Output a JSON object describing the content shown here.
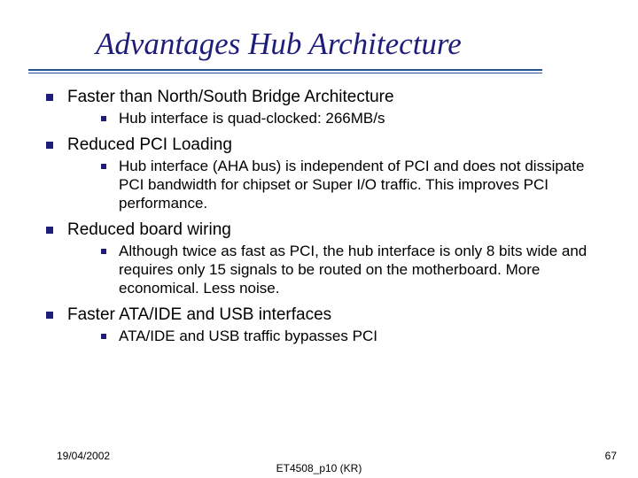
{
  "title": "Advantages Hub Architecture",
  "bullets": [
    {
      "text": "Faster than North/South Bridge Architecture",
      "sub": [
        "Hub interface is quad-clocked: 266MB/s"
      ]
    },
    {
      "text": "Reduced PCI Loading",
      "sub": [
        "Hub interface (AHA bus) is independent of PCI and does not dissipate PCI bandwidth for chipset or Super I/O traffic. This improves PCI performance."
      ]
    },
    {
      "text": "Reduced board wiring",
      "sub": [
        "Although twice as fast as PCI, the hub interface is only 8 bits wide and requires only 15 signals to be routed on the motherboard. More economical. Less noise."
      ]
    },
    {
      "text": "Faster ATA/IDE and USB interfaces",
      "sub": [
        "ATA/IDE and USB traffic bypasses PCI"
      ]
    }
  ],
  "footer": {
    "date": "19/04/2002",
    "center": "ET4508_p10 (KR)",
    "pageno": "67"
  }
}
